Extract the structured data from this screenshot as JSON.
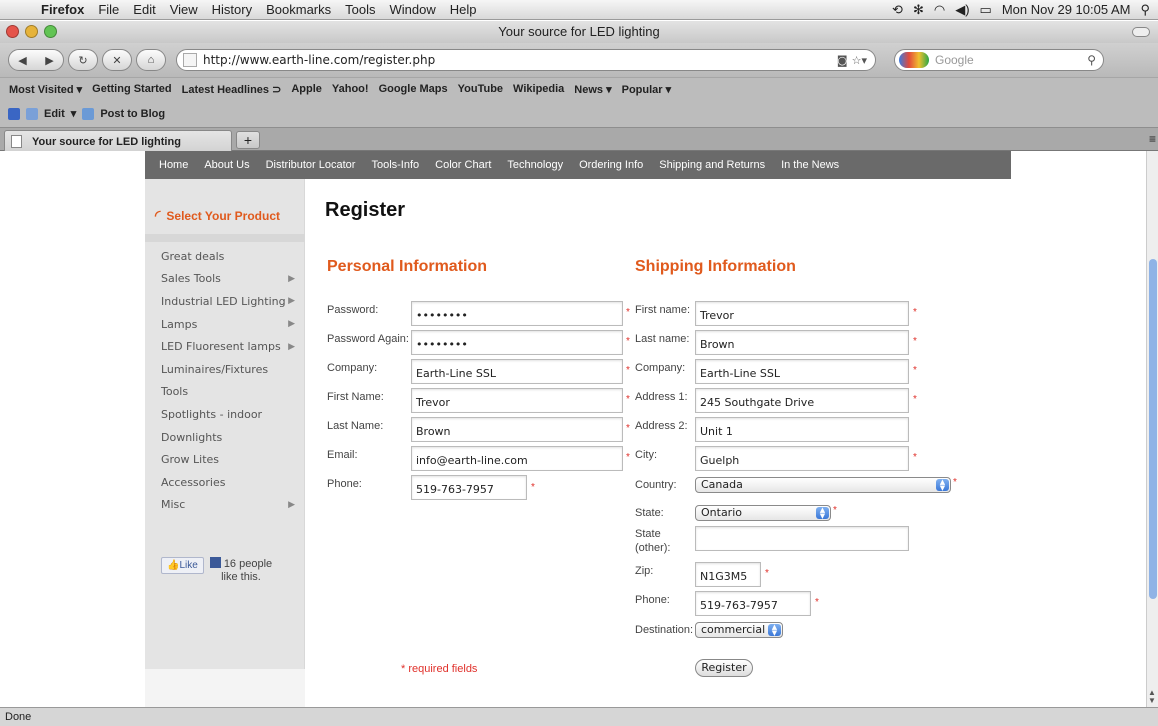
{
  "menubar": {
    "app": "Firefox",
    "items": [
      "File",
      "Edit",
      "View",
      "History",
      "Bookmarks",
      "Tools",
      "Window",
      "Help"
    ],
    "clock": "Mon Nov 29  10:05 AM"
  },
  "window": {
    "title": "Your source for LED lighting"
  },
  "nav": {
    "url": "http://www.earth-line.com/register.php",
    "search_placeholder": "Google"
  },
  "bookmarks": [
    "Most Visited ▾",
    "Getting Started",
    "Latest Headlines ⊃",
    "Apple",
    "Yahoo!",
    "Google Maps",
    "YouTube",
    "Wikipedia",
    "News ▾",
    "Popular ▾"
  ],
  "addons": {
    "edit": "Edit",
    "post": "Post to Blog"
  },
  "tab": {
    "title": "Your source for LED lighting",
    "new_tab": "+"
  },
  "site_nav": [
    "Home",
    "About Us",
    "Distributor Locator",
    "Tools-Info",
    "Color Chart",
    "Technology",
    "Ordering Info",
    "Shipping and Returns",
    "In the News"
  ],
  "sidebar": {
    "heading": "Select Your Product",
    "items": [
      {
        "label": "Great deals",
        "arrow": ""
      },
      {
        "label": "Sales Tools",
        "arrow": "▶"
      },
      {
        "label": "Industrial LED Lighting",
        "arrow": "▶"
      },
      {
        "label": "Lamps",
        "arrow": "▶"
      },
      {
        "label": "LED Fluoresent lamps",
        "arrow": "▶"
      },
      {
        "label": "Luminaires/Fixtures",
        "arrow": ""
      },
      {
        "label": "Tools",
        "arrow": ""
      },
      {
        "label": "Spotlights - indoor",
        "arrow": ""
      },
      {
        "label": "Downlights",
        "arrow": ""
      },
      {
        "label": "Grow Lites",
        "arrow": ""
      },
      {
        "label": "Accessories",
        "arrow": ""
      },
      {
        "label": "Misc",
        "arrow": "▶"
      }
    ],
    "like_label": "Like",
    "like_count": "16 people",
    "like_suffix": "like this."
  },
  "page": {
    "title": "Register",
    "personal_heading": "Personal Information",
    "shipping_heading": "Shipping Information",
    "required_note": "* required fields",
    "register_button": "Register"
  },
  "personal": {
    "password_label": "Password:",
    "password_value": "••••••••",
    "password2_label": "Password Again:",
    "password2_value": "••••••••",
    "company_label": "Company:",
    "company_value": "Earth-Line SSL",
    "first_label": "First Name:",
    "first_value": "Trevor",
    "last_label": "Last Name:",
    "last_value": "Brown",
    "email_label": "Email:",
    "email_value": "info@earth-line.com",
    "phone_label": "Phone:",
    "phone_value": "519-763-7957"
  },
  "shipping": {
    "first_label": "First name:",
    "first_value": "Trevor",
    "last_label": "Last name:",
    "last_value": "Brown",
    "company_label": "Company:",
    "company_value": "Earth-Line SSL",
    "address1_label": "Address 1:",
    "address1_value": "245 Southgate Drive",
    "address2_label": "Address 2:",
    "address2_value": "Unit 1",
    "city_label": "City:",
    "city_value": "Guelph",
    "country_label": "Country:",
    "country_value": "Canada",
    "state_label": "State:",
    "state_value": "Ontario",
    "state_other_label": "State (other):",
    "state_other_value": "",
    "zip_label": "Zip:",
    "zip_value": "N1G3M5",
    "phone_label": "Phone:",
    "phone_value": "519-763-7957",
    "destination_label": "Destination:",
    "destination_value": "commercial"
  },
  "status": "Done",
  "required_mark": "*",
  "colors": {
    "accent": "#e05a1d",
    "required": "#e0302a",
    "nav_bg": "#6a6a6a"
  }
}
